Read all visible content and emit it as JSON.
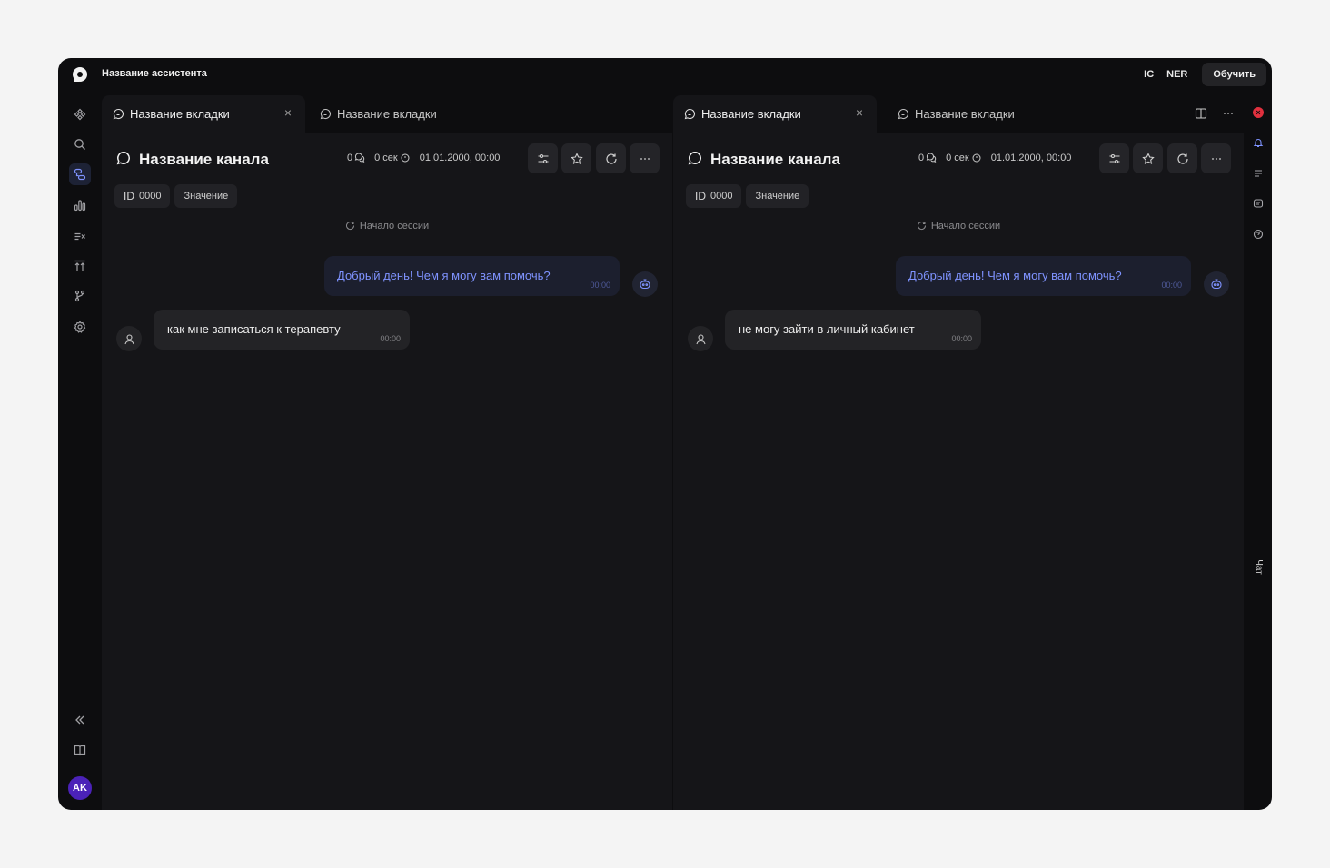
{
  "app": {
    "title": "Название ассистента",
    "nav_ic": "IC",
    "nav_ner": "NER",
    "train_button": "Обучить"
  },
  "sidebar": {
    "items": [
      "components-icon",
      "search-icon",
      "dialogs-icon",
      "analytics-icon",
      "sort-icon",
      "upload-icon",
      "branch-icon",
      "settings-icon"
    ],
    "active": "dialogs-icon",
    "bottom": [
      "collapse-icon",
      "book-icon"
    ],
    "avatar_initials": "AK",
    "avatar_color": "#4b22b8"
  },
  "right_rail": {
    "items": [
      "close-icon",
      "notification-icon",
      "list-icon",
      "chat-icon",
      "help-icon"
    ],
    "chat_label": "Чат"
  },
  "panels": [
    {
      "tabs": [
        {
          "label": "Название вкладки",
          "active": true
        },
        {
          "label": "Название вкладки",
          "active": false
        }
      ],
      "channel_title": "Название канала",
      "stats": {
        "messages": "0",
        "duration": "0 сек",
        "datetime": "01.01.2000, 00:00"
      },
      "chips": {
        "id_label": "ID",
        "id_value": "0000",
        "value": "Значение"
      },
      "session_label": "Начало сессии",
      "bot_message": {
        "text": "Добрый день! Чем я могу вам помочь?",
        "time": "00:00"
      },
      "user_message": {
        "text": "как мне записаться к терапевту",
        "time": "00:00"
      }
    },
    {
      "tabs": [
        {
          "label": "Название вкладки",
          "active": true
        },
        {
          "label": "Название вкладки",
          "active": false
        }
      ],
      "channel_title": "Название канала",
      "stats": {
        "messages": "0",
        "duration": "0 сек",
        "datetime": "01.01.2000, 00:00"
      },
      "chips": {
        "id_label": "ID",
        "id_value": "0000",
        "value": "Значение"
      },
      "session_label": "Начало сессии",
      "bot_message": {
        "text": "Добрый день! Чем я могу вам помочь?",
        "time": "00:00"
      },
      "user_message": {
        "text": "не могу зайти в личный кабинет",
        "time": "00:00"
      }
    }
  ],
  "colors": {
    "background": "#0d0d0f",
    "panel": "#151518",
    "accent": "#7f93ff",
    "danger": "#e0303e"
  }
}
